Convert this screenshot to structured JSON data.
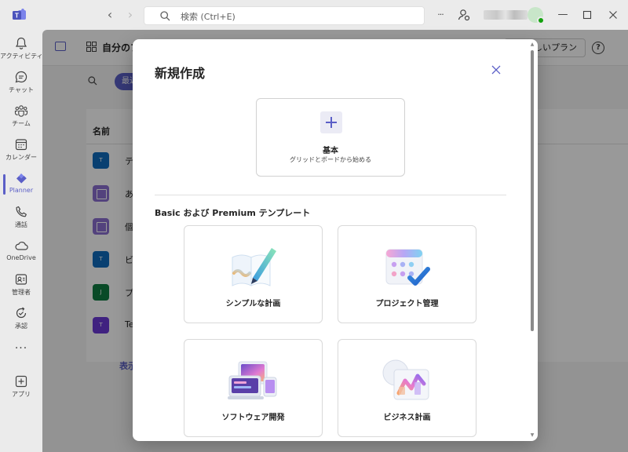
{
  "titlebar": {
    "search_placeholder": "検索 (Ctrl+E)",
    "more_label": "···"
  },
  "rail": {
    "items": [
      {
        "label": "アクティビティ",
        "icon": "bell-icon"
      },
      {
        "label": "チャット",
        "icon": "chat-icon"
      },
      {
        "label": "チーム",
        "icon": "teams-icon"
      },
      {
        "label": "カレンダー",
        "icon": "calendar-icon"
      },
      {
        "label": "Planner",
        "icon": "planner-icon",
        "active": true
      },
      {
        "label": "通話",
        "icon": "phone-icon"
      },
      {
        "label": "OneDrive",
        "icon": "cloud-icon"
      },
      {
        "label": "管理者",
        "icon": "admin-icon"
      },
      {
        "label": "承認",
        "icon": "approval-icon"
      }
    ],
    "more": "···",
    "apps_label": "アプリ"
  },
  "background": {
    "title": "自分のプ",
    "new_plan_button": "しいプラン",
    "recent_filter": "最近",
    "column_name": "名前",
    "plans": [
      {
        "icon_text": "T",
        "name": "テ",
        "color": "#0f6cbd",
        "grid": false
      },
      {
        "icon_text": "",
        "name": "あ",
        "color": "#8a6ed0",
        "grid": true
      },
      {
        "icon_text": "",
        "name": "個",
        "color": "#8a6ed0",
        "grid": true
      },
      {
        "icon_text": "T",
        "name": "ビ",
        "color": "#0f6cbd",
        "grid": false
      },
      {
        "icon_text": "J",
        "name": "プ",
        "color": "#107c41",
        "grid": false
      },
      {
        "icon_text": "T",
        "name": "Tea",
        "color": "#6b3ad6",
        "grid": false
      }
    ],
    "show_more": "表示"
  },
  "dialog": {
    "title": "新規作成",
    "basic": {
      "title": "基本",
      "description": "グリッドとボードから始める"
    },
    "section_title": "Basic および Premium テンプレート",
    "templates": [
      {
        "label": "シンプルな計画",
        "illustration": "pen-notebook-illustration"
      },
      {
        "label": "プロジェクト管理",
        "illustration": "calendar-check-illustration"
      },
      {
        "label": "ソフトウェア開発",
        "illustration": "devices-illustration"
      },
      {
        "label": "ビジネス計画",
        "illustration": "chart-illustration"
      }
    ]
  },
  "colors": {
    "accent": "#5b5fc7",
    "presence": "#13a10e"
  }
}
